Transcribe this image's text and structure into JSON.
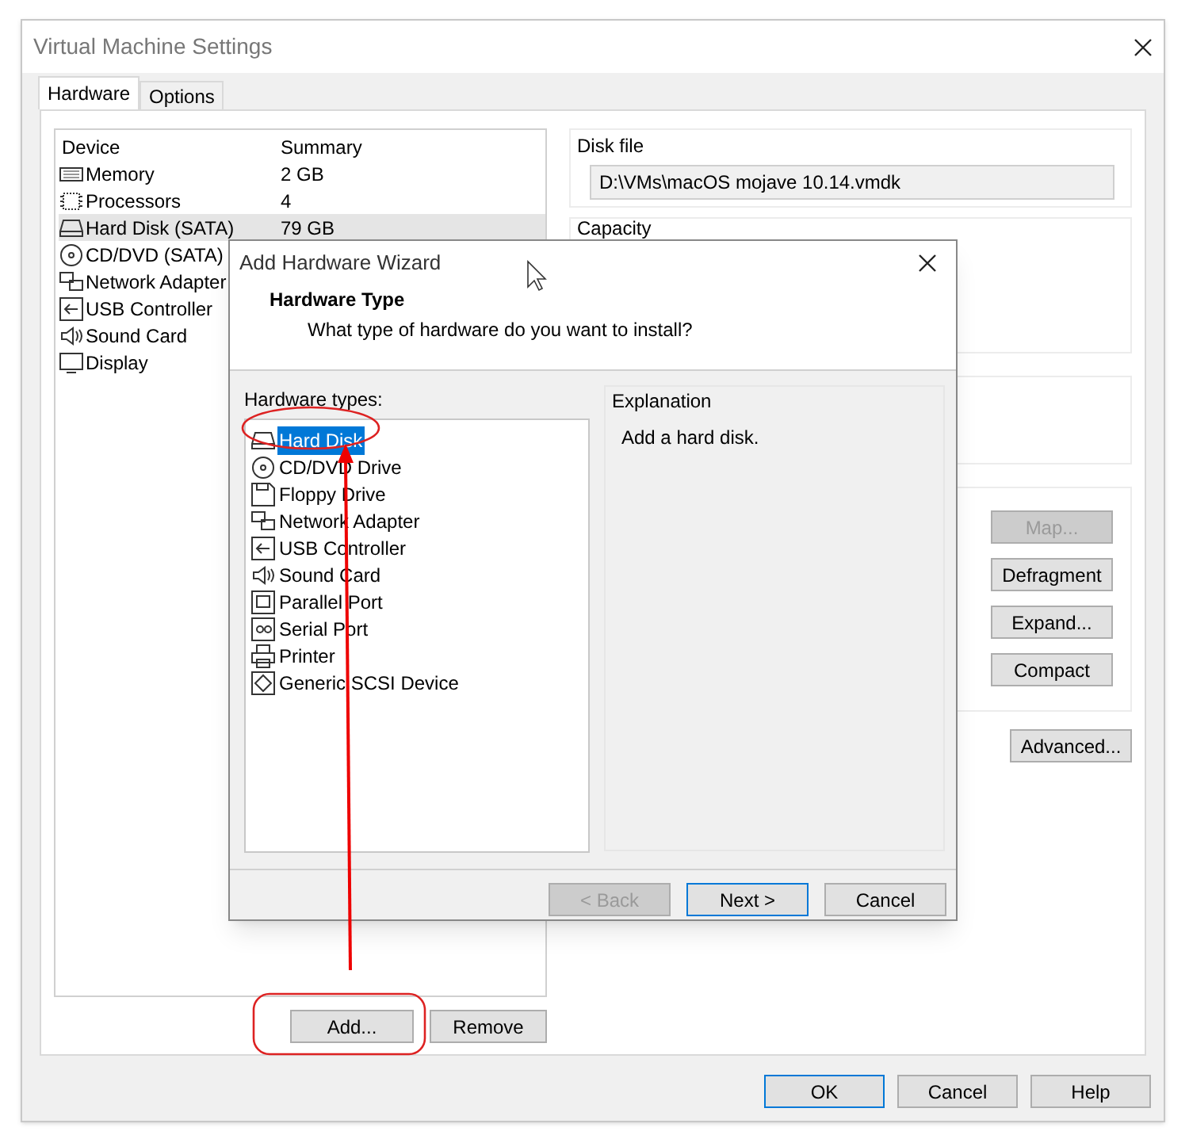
{
  "window": {
    "title": "Virtual Machine Settings"
  },
  "tabs": [
    {
      "label": "Hardware",
      "selected": true
    },
    {
      "label": "Options",
      "selected": false
    }
  ],
  "device_list": {
    "columns": [
      "Device",
      "Summary"
    ],
    "rows": [
      {
        "device": "Memory",
        "summary": "2 GB",
        "selected": false
      },
      {
        "device": "Processors",
        "summary": "4",
        "selected": false
      },
      {
        "device": "Hard Disk (SATA)",
        "summary": "79 GB",
        "selected": true
      },
      {
        "device": "CD/DVD (SATA)",
        "selected": false
      },
      {
        "device": "Network Adapter",
        "selected": false
      },
      {
        "device": "USB Controller",
        "selected": false
      },
      {
        "device": "Sound Card",
        "selected": false
      },
      {
        "device": "Display",
        "selected": false
      }
    ]
  },
  "list_buttons": [
    {
      "label": "Add..."
    },
    {
      "label": "Remove"
    }
  ],
  "disk_file": {
    "label": "Disk file",
    "value": "D:\\VMs\\macOS mojave 10.14.vmdk"
  },
  "capacity": {
    "label": "Capacity"
  },
  "disk_utility_buttons": [
    {
      "label": "Map...",
      "disabled": true
    },
    {
      "label": "Defragment",
      "disabled": false
    },
    {
      "label": "Expand...",
      "disabled": false
    },
    {
      "label": "Compact",
      "disabled": false
    }
  ],
  "advanced_button": {
    "label": "Advanced..."
  },
  "dialog_buttons": [
    {
      "label": "OK",
      "default": true
    },
    {
      "label": "Cancel",
      "default": false
    },
    {
      "label": "Help",
      "default": false
    }
  ],
  "wizard": {
    "title": "Add Hardware Wizard",
    "heading": "Hardware Type",
    "subheading": "What type of hardware do you want to install?",
    "list_label": "Hardware types:",
    "items": [
      {
        "label": "Hard Disk",
        "selected": true
      },
      {
        "label": "CD/DVD Drive",
        "selected": false
      },
      {
        "label": "Floppy Drive",
        "selected": false
      },
      {
        "label": "Network Adapter",
        "selected": false
      },
      {
        "label": "USB Controller",
        "selected": false
      },
      {
        "label": "Sound Card",
        "selected": false
      },
      {
        "label": "Parallel Port",
        "selected": false
      },
      {
        "label": "Serial Port",
        "selected": false
      },
      {
        "label": "Printer",
        "selected": false
      },
      {
        "label": "Generic SCSI Device",
        "selected": false
      }
    ],
    "explanation_label": "Explanation",
    "explanation": "Add a hard disk.",
    "buttons": [
      {
        "label": "< Back",
        "disabled": true,
        "default": false
      },
      {
        "label": "Next >",
        "disabled": false,
        "default": true
      },
      {
        "label": "Cancel",
        "disabled": false,
        "default": false
      }
    ]
  }
}
